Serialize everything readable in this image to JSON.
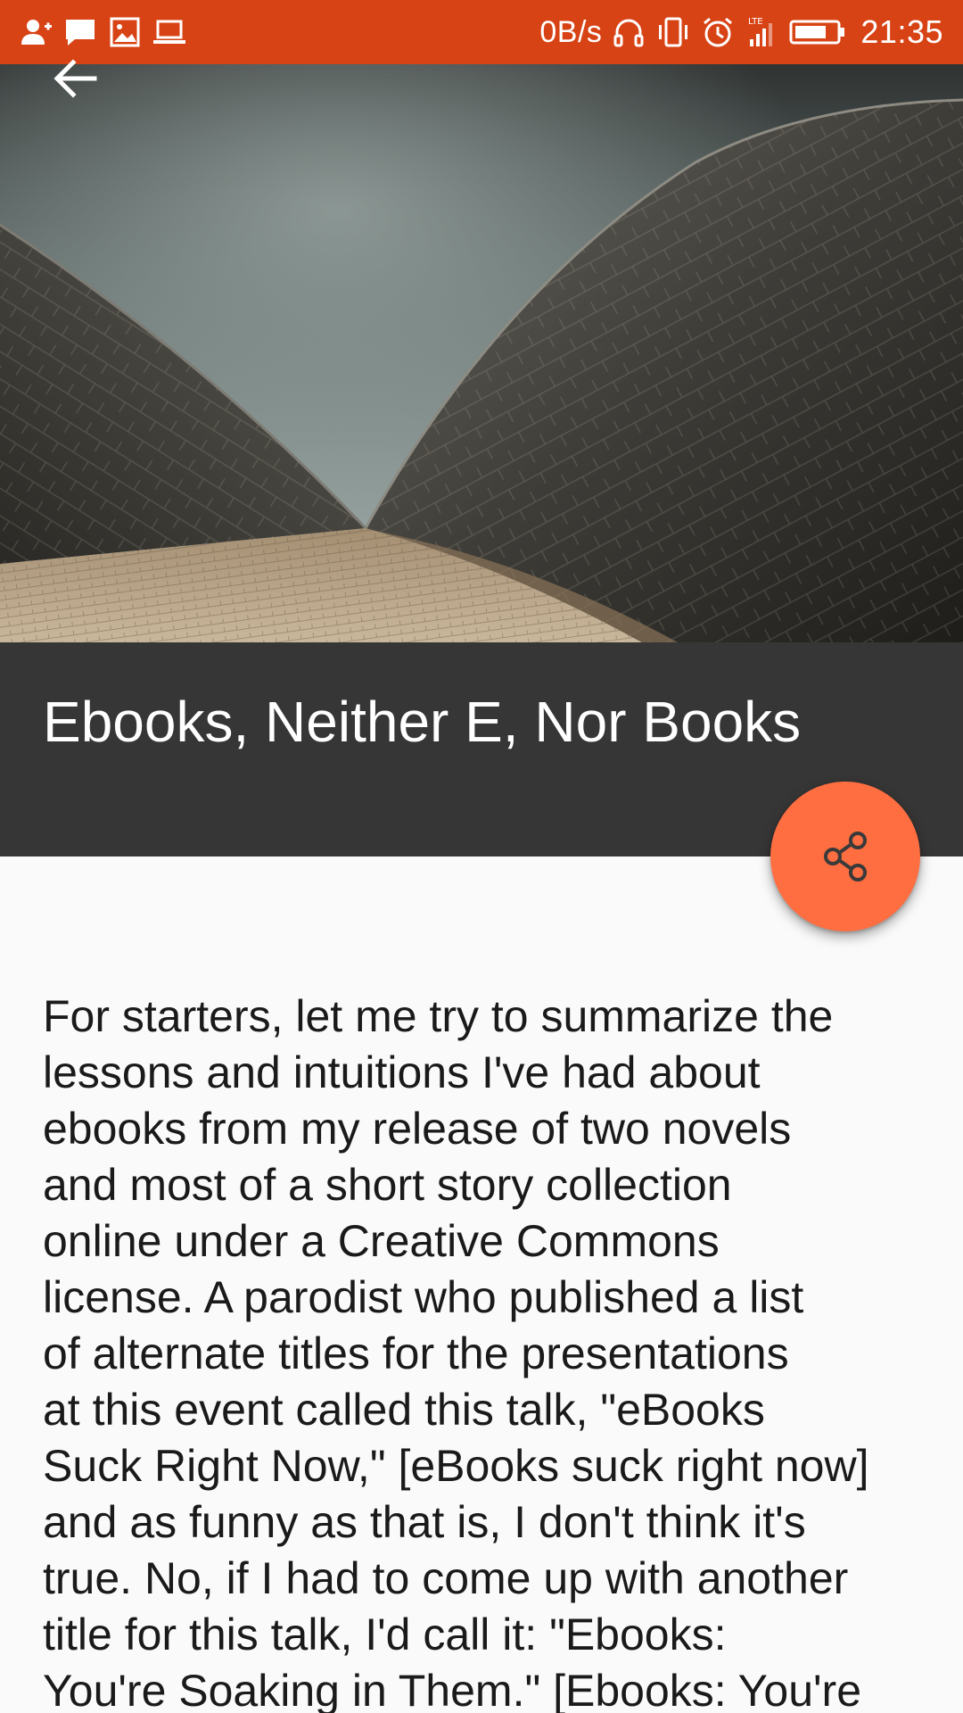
{
  "status_bar": {
    "network_speed": "0B/s",
    "network_type": "LTE",
    "time": "21:35",
    "background_color": "#d84315",
    "left_icons": [
      "add-user-icon",
      "message-icon",
      "image-icon",
      "laptop-icon"
    ],
    "right_icons": [
      "headset-icon",
      "vibrate-icon",
      "alarm-icon",
      "signal-icon",
      "battery-icon"
    ]
  },
  "toolbar": {
    "back_icon": "arrow-back-icon"
  },
  "article": {
    "title": "Ebooks, Neither E, Nor Books",
    "title_band_color": "#363636",
    "share_icon": "share-icon",
    "fab_color": "#ff6e40",
    "body_lines": [
      "For starters, let me try to summarize the",
      "lessons and intuitions I've had about",
      "ebooks from my release of two novels",
      "and most of a short story collection",
      "online under a Creative Commons",
      "license. A parodist who published a list",
      "of alternate titles for the presentations",
      "at this event called this talk, \"eBooks",
      "Suck Right Now,\" [eBooks suck right now]",
      "and as funny as that is, I don't think it's",
      "true. No, if I had to come up with another",
      "title for this talk, I'd call it: \"Ebooks:",
      "You're Soaking in Them.\" [Ebooks: You're"
    ]
  }
}
